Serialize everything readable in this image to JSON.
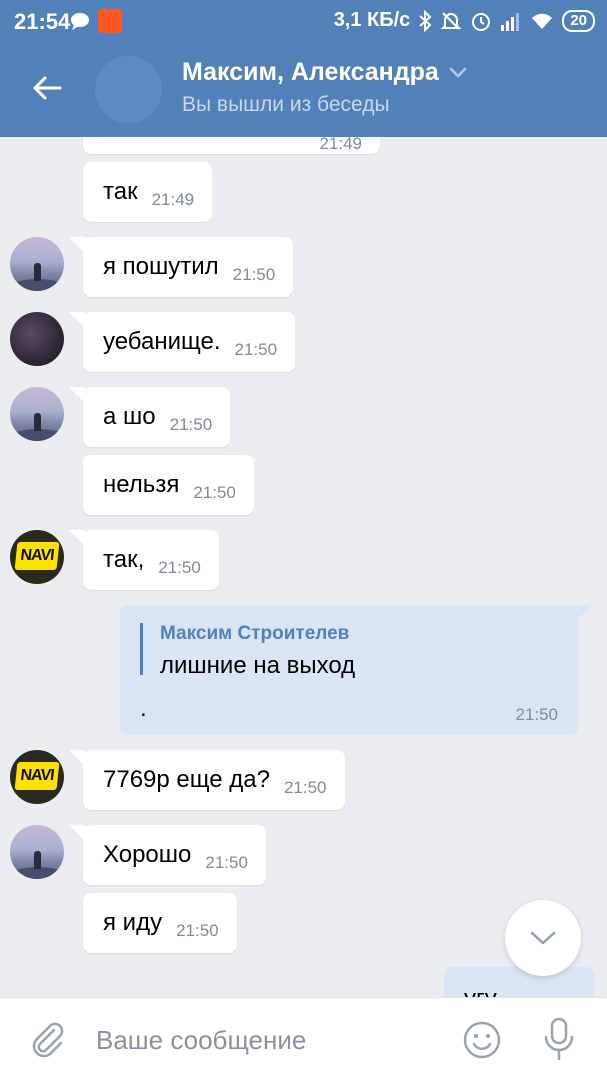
{
  "status_bar": {
    "time": "21:54",
    "network_speed": "3,1 КБ/с",
    "battery": "20"
  },
  "header": {
    "title": "Максим, Александра",
    "subtitle": "Вы вышли из беседы"
  },
  "messages": [
    {
      "text": "так",
      "time": "21:49"
    },
    {
      "text": "я пошутил",
      "time": "21:50"
    },
    {
      "text": "уебанище.",
      "time": "21:50"
    },
    {
      "text": "а шо",
      "time": "21:50"
    },
    {
      "text": "нельзя",
      "time": "21:50"
    },
    {
      "text": "так,",
      "time": "21:50"
    },
    {
      "text": "7769р еще да?",
      "time": "21:50"
    },
    {
      "text": "Хорошо",
      "time": "21:50"
    },
    {
      "text": "я иду",
      "time": "21:50"
    }
  ],
  "partial_top": {
    "time": "21:49"
  },
  "outgoing": {
    "quote_name": "Максим Строителев",
    "quote_text": "лишние на выход",
    "text": ".",
    "time": "21:50"
  },
  "partial_bottom": {
    "text": "угу"
  },
  "composer": {
    "placeholder": "Ваше сообщение"
  },
  "colors": {
    "header_bg": "#5181b8",
    "chat_bg": "#ebedf1",
    "outgoing_bubble": "#dae6f5",
    "navi_yellow": "#ffe100"
  }
}
